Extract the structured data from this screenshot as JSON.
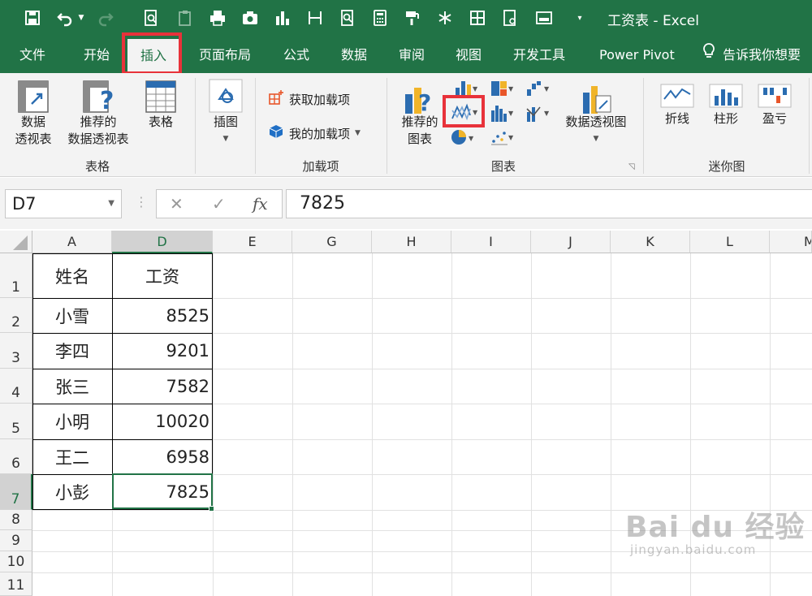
{
  "window": {
    "title": "工资表  -  Excel"
  },
  "tabs": [
    {
      "label": "文件"
    },
    {
      "label": "开始"
    },
    {
      "label": "插入"
    },
    {
      "label": "页面布局"
    },
    {
      "label": "公式"
    },
    {
      "label": "数据"
    },
    {
      "label": "审阅"
    },
    {
      "label": "视图"
    },
    {
      "label": "开发工具"
    },
    {
      "label": "Power Pivot"
    },
    {
      "label": "告诉我你想要"
    }
  ],
  "ribbon": {
    "table_group": {
      "pivot_line1": "数据",
      "pivot_line2": "透视表",
      "recommended_pivot_line1": "推荐的",
      "recommended_pivot_line2": "数据透视表",
      "table": "表格",
      "label": "表格"
    },
    "illustration": {
      "label": "插图"
    },
    "addins": {
      "get": "获取加载项",
      "mine": "我的加载项",
      "label": "加载项"
    },
    "charts": {
      "recommended_line1": "推荐的",
      "recommended_line2": "图表",
      "pivot_chart": "数据透视图",
      "label": "图表"
    },
    "sparklines": {
      "line": "折线",
      "column": "柱形",
      "winloss": "盈亏",
      "label": "迷你图"
    }
  },
  "formula_bar": {
    "name_box": "D7",
    "cancel": "✕",
    "enter": "✓",
    "fx": "fx",
    "value": "7825"
  },
  "columns": [
    "A",
    "D",
    "E",
    "G",
    "H",
    "I",
    "J",
    "K",
    "L",
    "M"
  ],
  "rows": [
    "1",
    "2",
    "3",
    "4",
    "5",
    "6",
    "7",
    "8",
    "9",
    "10",
    "11"
  ],
  "table": {
    "header": {
      "name": "姓名",
      "salary": "工资"
    },
    "records": [
      {
        "name": "小雪",
        "salary": "8525"
      },
      {
        "name": "李四",
        "salary": "9201"
      },
      {
        "name": "张三",
        "salary": "7582"
      },
      {
        "name": "小明",
        "salary": "10020"
      },
      {
        "name": "王二",
        "salary": "6958"
      },
      {
        "name": "小彭",
        "salary": "7825"
      }
    ]
  },
  "watermark": {
    "brand": "Bai du 经验",
    "url": "jingyan.baidu.com"
  },
  "colors": {
    "excel_green": "#217346",
    "highlight_red": "#e8323a"
  }
}
